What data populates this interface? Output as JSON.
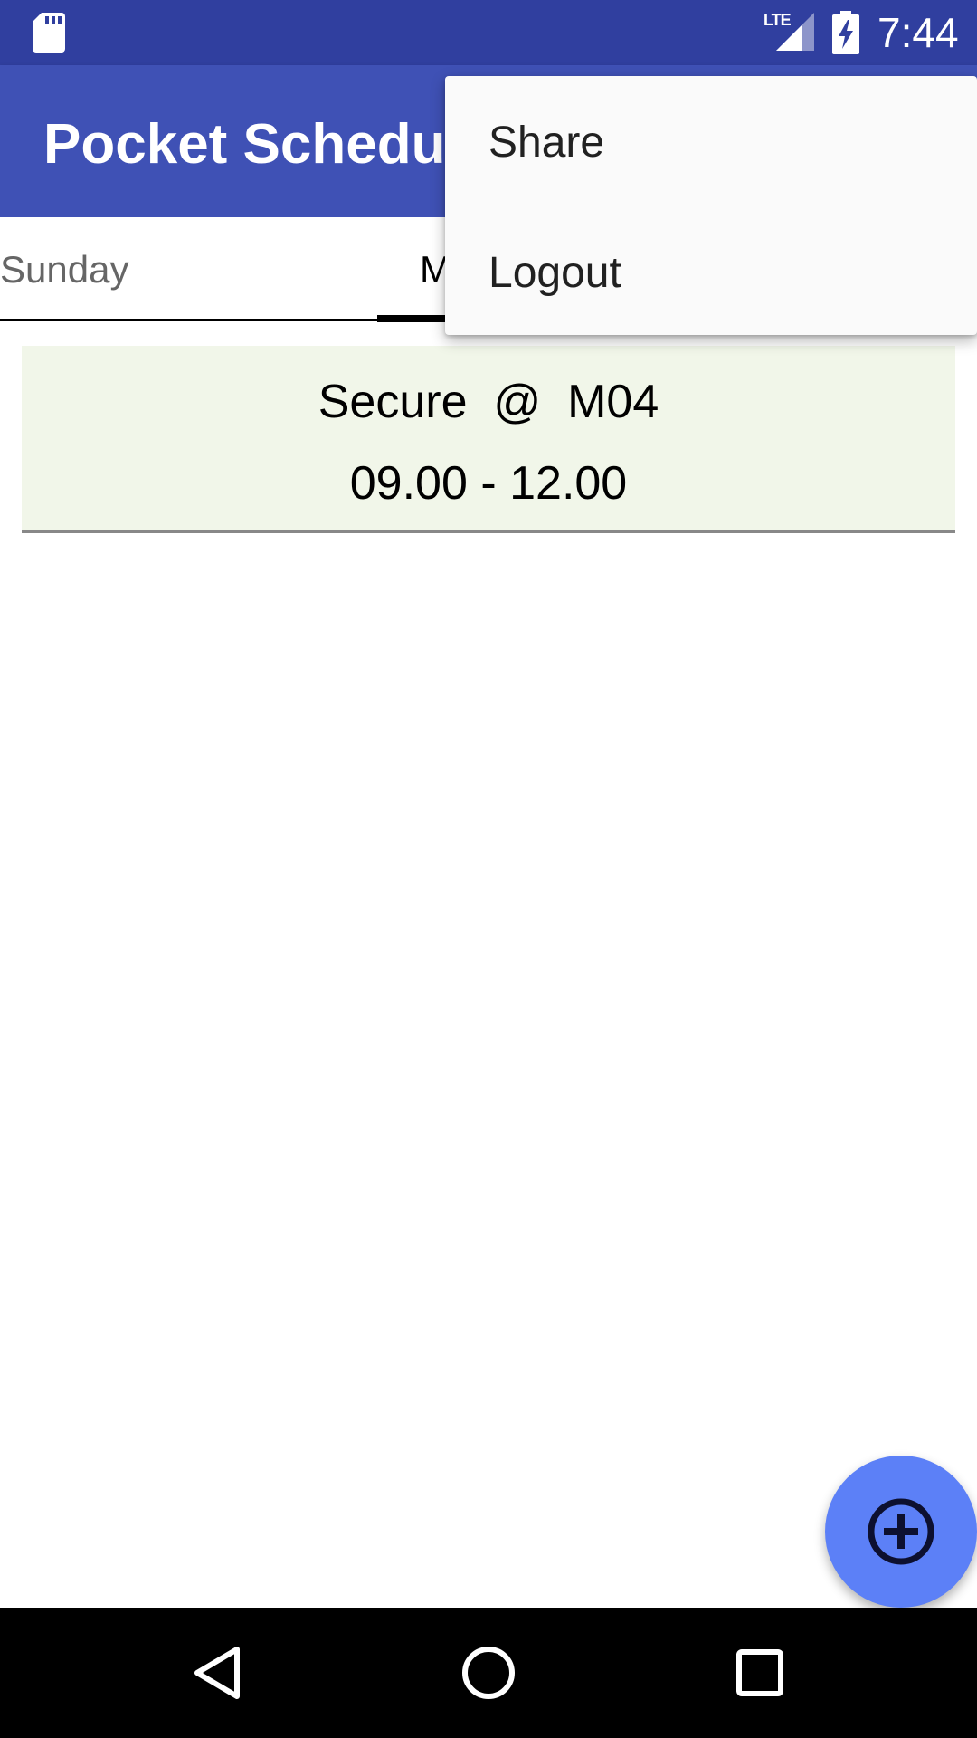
{
  "status_bar": {
    "time": "7:44",
    "network_label": "LTE",
    "icons": [
      "sd-card-icon",
      "lte-signal-icon",
      "battery-charging-icon"
    ]
  },
  "app_bar": {
    "title": "Pocket Schedule",
    "background_color": "#3f51b5",
    "status_color": "#303f9f"
  },
  "tabs": {
    "items": [
      {
        "label": "Sunday",
        "selected": false
      },
      {
        "label": "M",
        "selected": true
      }
    ]
  },
  "schedule": {
    "entries": [
      {
        "title": "Secure  @  M04",
        "time": "09.00 - 12.00",
        "background_color": "#f1f6e9"
      }
    ]
  },
  "overflow_menu": {
    "items": [
      {
        "label": "Share"
      },
      {
        "label": "Logout"
      }
    ]
  },
  "fab": {
    "icon": "add-circle-icon",
    "color": "#5c80f7"
  },
  "nav_bar": {
    "icons": [
      "back-icon",
      "home-icon",
      "recents-icon"
    ]
  }
}
